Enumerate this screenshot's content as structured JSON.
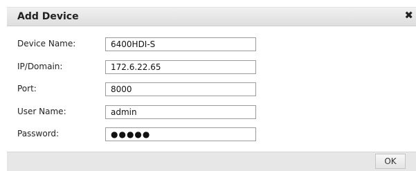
{
  "dialog": {
    "title": "Add Device",
    "close_icon": "close-icon",
    "close_glyph": "✖"
  },
  "fields": [
    {
      "label": "Device Name:",
      "value": "6400HDI-S"
    },
    {
      "label": "IP/Domain:",
      "value": "172.6.22.65"
    },
    {
      "label": "Port:",
      "value": "8000"
    },
    {
      "label": "User Name:",
      "value": "admin"
    },
    {
      "label": "Password:",
      "value": "●●●●●"
    }
  ],
  "footer": {
    "ok_label": "OK"
  }
}
